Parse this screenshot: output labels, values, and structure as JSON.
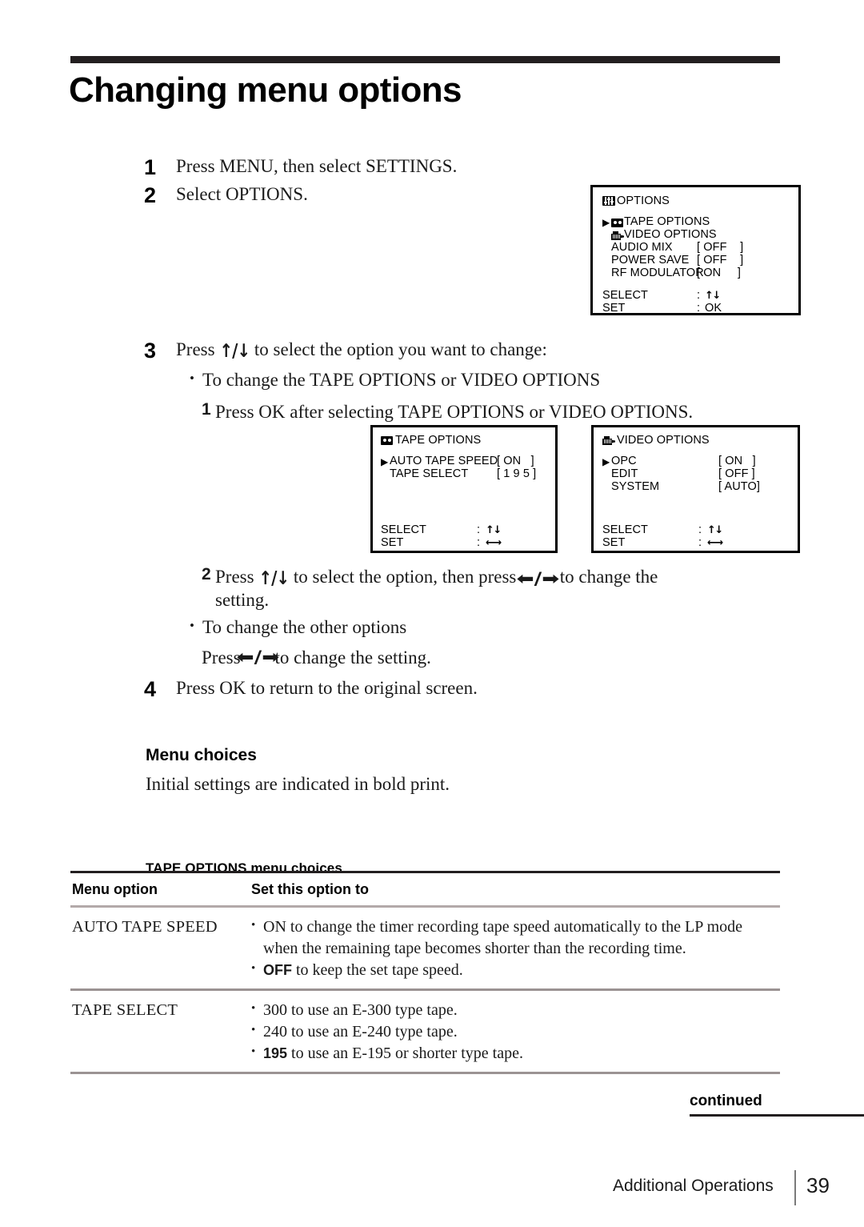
{
  "page": {
    "title": "Changing menu options",
    "footer_section": "Additional Operations",
    "footer_page_number": "39",
    "continued_label": "continued"
  },
  "steps": [
    {
      "num": "1",
      "text": "Press MENU, then select SETTINGS."
    },
    {
      "num": "2",
      "text": "Select OPTIONS."
    },
    {
      "num": "3",
      "text_before": "Press ",
      "arrows": "↑/↓",
      "text_after": " to select the option you want to change:"
    },
    {
      "num": "4",
      "text": "Press OK to return to the original screen."
    }
  ],
  "substeps": {
    "bullet1": "To change the TAPE OPTIONS or VIDEO OPTIONS",
    "bullet1_step1_num": "1",
    "bullet1_step1": "Press OK after selecting TAPE OPTIONS or VIDEO OPTIONS.",
    "bullet1_step2_num": "2",
    "bullet1_step2_a": "Press ",
    "bullet1_step2_b": " to select the option, then press ",
    "bullet1_step2_c": " to change the",
    "bullet1_step2_d": "setting.",
    "bullet2": "To change the other options",
    "bullet2_line_a": "Press ",
    "bullet2_line_b": " to change the setting."
  },
  "osd_options": {
    "title": "OPTIONS",
    "title_icon": "slider-icon",
    "rows": [
      {
        "caret": "▶",
        "icon": "cassette-icon",
        "label": "TAPE OPTIONS",
        "value": ""
      },
      {
        "caret": "",
        "icon": "camcorder-icon",
        "label": "VIDEO OPTIONS",
        "value": ""
      },
      {
        "caret": "",
        "icon": "",
        "label": "AUDIO MIX",
        "value": "[ OFF    ]"
      },
      {
        "caret": "",
        "icon": "",
        "label": "POWER SAVE",
        "value": "[ OFF    ]"
      },
      {
        "caret": "",
        "icon": "",
        "label": "RF MODULATOR",
        "value": "[ ON     ]"
      }
    ],
    "footer": [
      {
        "key": "SELECT",
        "sep": ":",
        "val": "↑↓",
        "val_kind": "updown"
      },
      {
        "key": "SET",
        "sep": ":",
        "val": "OK",
        "val_kind": "text"
      }
    ]
  },
  "osd_tape_options": {
    "title": "TAPE OPTIONS",
    "title_icon": "cassette-icon",
    "rows": [
      {
        "caret": "▶",
        "label": "AUTO TAPE SPEED",
        "value": "[ ON   ]"
      },
      {
        "caret": "",
        "label": "TAPE SELECT",
        "value": "[ 1 9 5 ]"
      }
    ],
    "footer": [
      {
        "key": "SELECT",
        "sep": ":",
        "val": "↑↓",
        "val_kind": "updown"
      },
      {
        "key": "SET",
        "sep": ":",
        "val": "←→",
        "val_kind": "leftright"
      }
    ]
  },
  "osd_video_options": {
    "title": "VIDEO OPTIONS",
    "title_icon": "camcorder-icon",
    "rows": [
      {
        "caret": "▶",
        "label": "OPC",
        "value": "[ ON   ]"
      },
      {
        "caret": "",
        "label": "EDIT",
        "value": "[ OFF ]"
      },
      {
        "caret": "",
        "label": "SYSTEM",
        "value": "[ AUTO]"
      }
    ],
    "footer": [
      {
        "key": "SELECT",
        "sep": ":",
        "val": "↑↓",
        "val_kind": "updown"
      },
      {
        "key": "SET",
        "sep": ":",
        "val": "←→",
        "val_kind": "leftright"
      }
    ]
  },
  "menu_choices": {
    "heading": "Menu choices",
    "subtext": "Initial settings are indicated in bold print.",
    "table_caption": "TAPE OPTIONS menu choices",
    "columns": [
      "Menu option",
      "Set this option to"
    ],
    "rows": [
      {
        "option": "AUTO TAPE SPEED",
        "bullets": [
          {
            "bold": "",
            "text": "ON to change the timer recording tape speed automatically to the LP mode when the remaining tape becomes shorter than the recording time."
          },
          {
            "bold": "OFF",
            "text": " to keep the set tape speed."
          }
        ]
      },
      {
        "option": "TAPE SELECT",
        "bullets": [
          {
            "bold": "",
            "text": "300 to use an E-300 type tape."
          },
          {
            "bold": "",
            "text": "240 to use an E-240 type tape."
          },
          {
            "bold": "195",
            "text": " to use an E-195 or shorter type tape."
          }
        ]
      }
    ]
  },
  "colors": {
    "rule_dark": "#231f20",
    "rule_light": "#b3a9a9",
    "text": "#1a1a1a"
  }
}
